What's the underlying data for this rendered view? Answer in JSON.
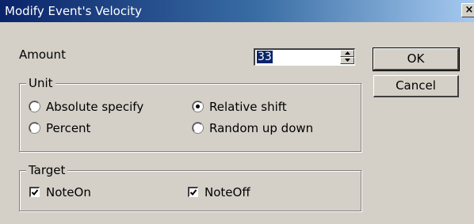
{
  "window": {
    "title": "Modify Event's Velocity",
    "close_icon": "×"
  },
  "amount": {
    "label": "Amount",
    "value": "33"
  },
  "buttons": {
    "ok": "OK",
    "cancel": "Cancel"
  },
  "unit": {
    "legend": "Unit",
    "options": [
      {
        "label": "Absolute specify",
        "selected": false
      },
      {
        "label": "Relative shift",
        "selected": true
      },
      {
        "label": "Percent",
        "selected": false
      },
      {
        "label": "Random up down",
        "selected": false
      }
    ]
  },
  "target": {
    "legend": "Target",
    "options": [
      {
        "label": "NoteOn",
        "checked": true
      },
      {
        "label": "NoteOff",
        "checked": true
      }
    ]
  },
  "colors": {
    "title_start": "#0a246a",
    "title_end": "#a6caf0",
    "face": "#d4d0c8",
    "selection": "#0a246a"
  }
}
